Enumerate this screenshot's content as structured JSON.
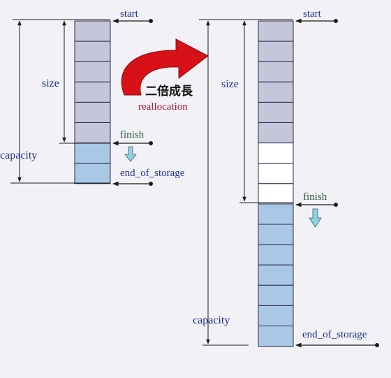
{
  "colors": {
    "background": "#f2f2f6",
    "used_cell": "#c4c6da",
    "free_cell_left": "#a9c8e6",
    "free_cell_right": "#ffffff",
    "new_cell": "#a9c8e6",
    "label_blue": "#1e2f8a",
    "label_green": "#2f5a3a",
    "arrow_red": "#d81018",
    "reallocation_text": "#b0102a",
    "down_arrow": "#8fd2e6"
  },
  "left": {
    "start": "start",
    "size": "size",
    "finish": "finish",
    "capacity": "capacity",
    "end_of_storage": "end_of_storage"
  },
  "right": {
    "start": "start",
    "size": "size",
    "finish": "finish",
    "capacity": "capacity",
    "end_of_storage": "end_of_storage"
  },
  "growth": {
    "chinese": "二倍成長",
    "english": "reallocation"
  }
}
